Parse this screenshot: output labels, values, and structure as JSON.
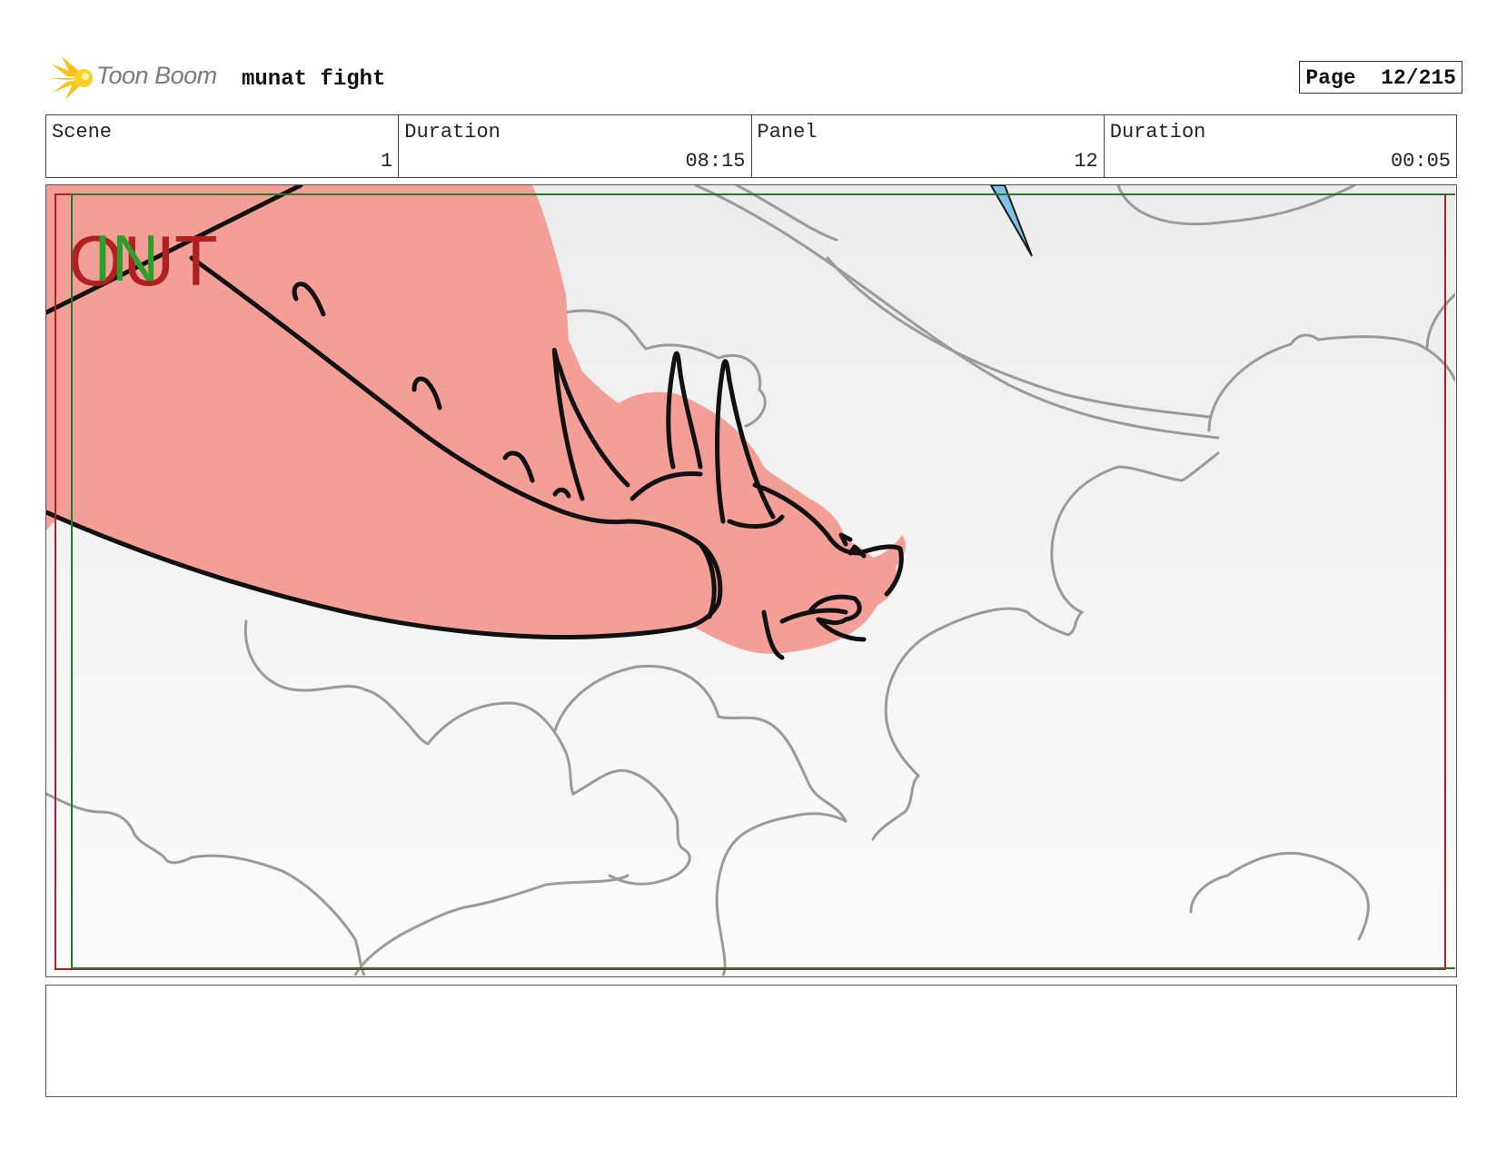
{
  "header": {
    "brand": "Toon Boom",
    "project_title": "munat fight",
    "page_label": "Page",
    "page_value": "12/215"
  },
  "info": {
    "scene_label": "Scene",
    "scene_value": "1",
    "scene_duration_label": "Duration",
    "scene_duration_value": "08:15",
    "panel_label": "Panel",
    "panel_value": "12",
    "panel_duration_label": "Duration",
    "panel_duration_value": "00:05"
  },
  "panel": {
    "overlay_out": "OUT",
    "overlay_in": "IN",
    "colors": {
      "dragon_fill": "#f49e98",
      "ink": "#000000",
      "cloud_line": "#9a9a9a",
      "out_frame": "#b02020",
      "in_frame": "#1f7a2a",
      "blade": "#7fbfe8"
    }
  },
  "notes": {
    "text": ""
  }
}
